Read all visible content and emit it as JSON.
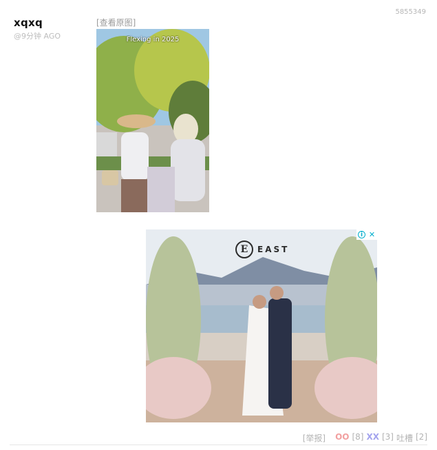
{
  "post": {
    "id": "5855349",
    "author": "xqxq",
    "time": "@9分钟 AGO",
    "view_original": "[查看原图]",
    "image_caption": "Flexing in 2025"
  },
  "ad": {
    "brand_mark": "E",
    "brand_name": "EAST",
    "info_icon": "info-icon",
    "close_icon": "close-icon",
    "info_glyph": "i",
    "close_glyph": "✕"
  },
  "footer": {
    "report": "[举报]",
    "oo_label": "OO",
    "oo_count": "[8]",
    "xx_label": "XX",
    "xx_count": "[3]",
    "tucao_label": "吐槽",
    "tucao_count": "[2]"
  },
  "colors": {
    "oo": "#f2a0a0",
    "xx": "#a3a3ee",
    "ad_accent": "#00aecd"
  }
}
